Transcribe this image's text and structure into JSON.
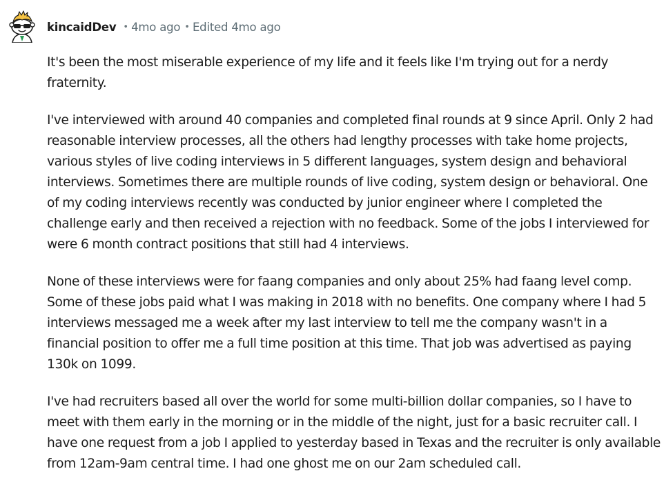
{
  "comment": {
    "author": "kincaidDev",
    "separator": "•",
    "posted_time": "4mo ago",
    "edited_label": "Edited 4mo ago",
    "avatar_icon": "reddit-snoo-avatar-icon",
    "paragraphs": [
      "It's been the most miserable experience of my life and it feels like I'm trying out for a nerdy fraternity.",
      "I've interviewed with around 40 companies and completed final rounds at 9 since April. Only 2 had reasonable interview processes, all the others had lengthy processes with take home projects, various styles of live coding interviews in 5 different languages, system design and behavioral interviews. Sometimes there are multiple rounds of live coding, system design or behavioral. One of my coding interviews recently was conducted by junior engineer where I completed the challenge early and then received a rejection with no feedback. Some of the jobs I interviewed for were 6 month contract positions that still had 4 interviews.",
      "None of these interviews were for faang companies and only about 25% had faang level comp. Some of these jobs paid what I was making in 2018 with no benefits. One company where I had 5 interviews messaged me a week after my last interview to tell me the company wasn't in a financial position to offer me a full time position at this time. That job was advertised as paying 130k on 1099.",
      "I've had recruiters based all over the world for some multi-billion dollar companies, so I have to meet with them early in the morning or in the middle of the night, just for a basic recruiter call. I have one request from a job I applied to yesterday based in Texas and the recruiter is only available from 12am-9am central time. I had one ghost me on our 2am scheduled call."
    ]
  },
  "colors": {
    "text": "#1c1c1c",
    "meta_text": "#5c6c74",
    "background": "#ffffff"
  }
}
